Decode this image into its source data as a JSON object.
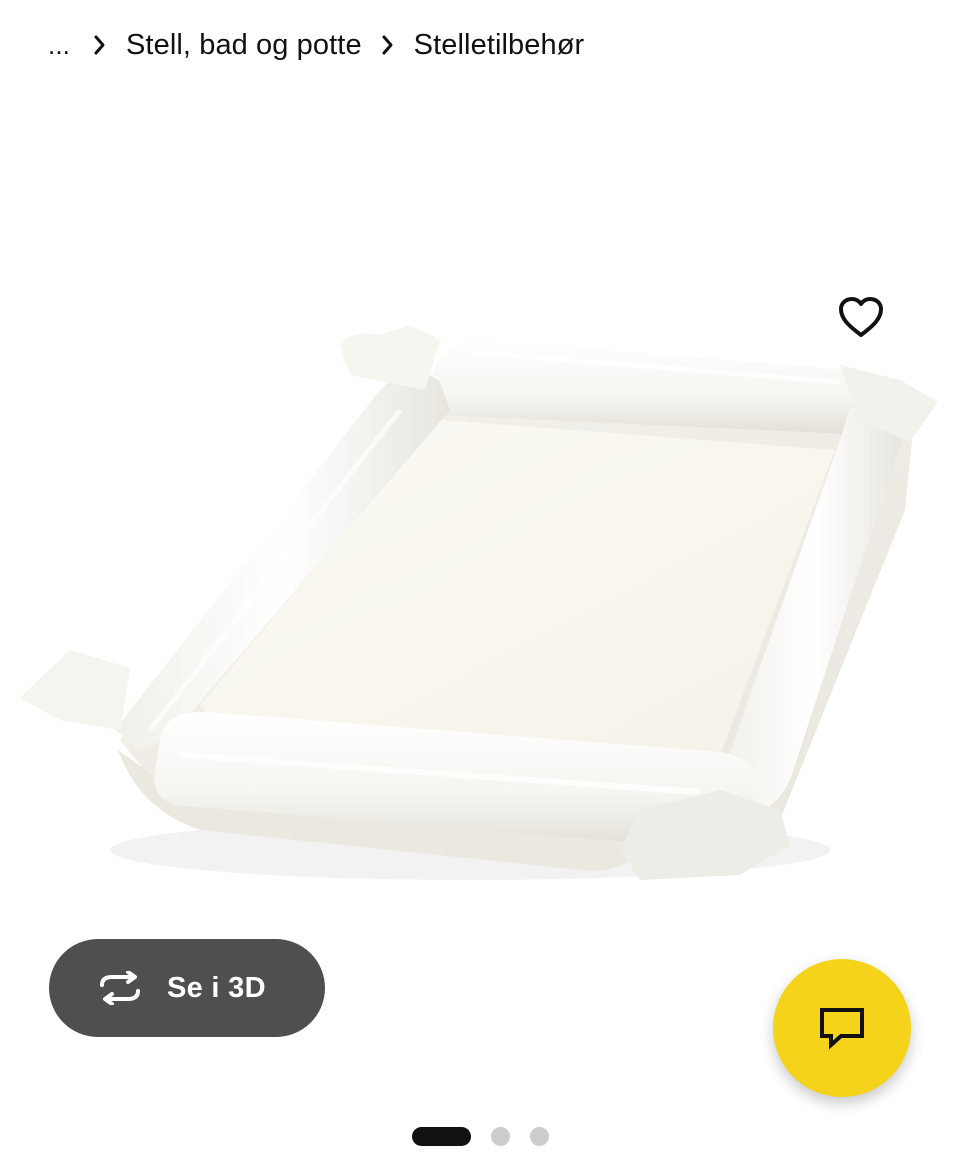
{
  "breadcrumb": {
    "ellipsis": "...",
    "items": [
      {
        "label": "Stell, bad og potte"
      },
      {
        "label": "Stelletilbehør"
      }
    ],
    "separator_icon": "chevron-right-icon"
  },
  "product": {
    "image_icon": "changing-pad-image",
    "favorite_icon": "heart-outline-icon",
    "view_3d": {
      "label": "Se i 3D",
      "icon": "rotate-360-icon",
      "background": "#4f4f4f"
    }
  },
  "chat": {
    "icon": "speech-bubble-icon",
    "background": "#f5d31a"
  },
  "pager": {
    "count": 3,
    "active_index": 0
  }
}
